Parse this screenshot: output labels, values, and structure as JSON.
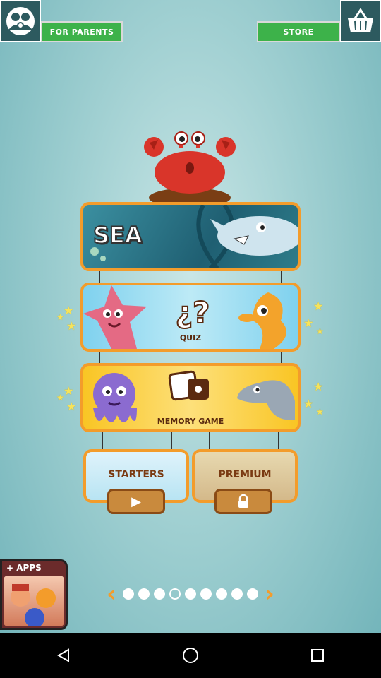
{
  "topbar": {
    "for_parents_label": "FOR PARENTS",
    "store_label": "STORE",
    "parents_icon": "parents-icon",
    "basket_icon": "basket-icon"
  },
  "menu": {
    "sea_label": "SEA",
    "quiz_symbol": "¿?",
    "quiz_label": "QUIZ",
    "memory_label": "MEMORY GAME",
    "starters_label": "STARTERS",
    "premium_label": "PREMIUM",
    "play_icon": "play-icon",
    "lock_icon": "lock-icon"
  },
  "apps": {
    "label": "+ APPS"
  },
  "pager": {
    "total_pages": 9,
    "active_page": 4,
    "prev_icon": "chevron-left-icon",
    "next_icon": "chevron-right-icon"
  },
  "navbar": {
    "back_icon": "back-icon",
    "home_icon": "home-icon",
    "recents_icon": "recents-icon"
  },
  "colors": {
    "accent_green": "#3db24a",
    "frame_orange": "#f39c2b",
    "background_teal": "#9fcfd1"
  }
}
